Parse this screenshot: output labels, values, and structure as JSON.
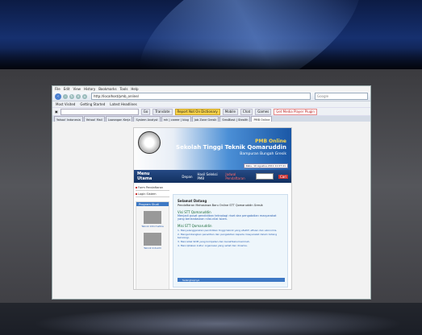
{
  "browser": {
    "menu": [
      "File",
      "Edit",
      "View",
      "History",
      "Bookmarks",
      "Tools",
      "Help"
    ],
    "url": "http://localhost/pmb_online/",
    "search_placeholder": "Google",
    "bookmarks": [
      "Most Visited",
      "Getting Started",
      "Latest Headlines"
    ],
    "toolbar_buttons": [
      "Go",
      "Translate",
      "Report Not On Dictionary",
      "Mobile",
      "Chat",
      "Games",
      "Get Media Player Plugin"
    ],
    "tabs": [
      "Yahoo! Indonesia",
      "Yahoo! Mail",
      "Lowongan Kerja",
      "System Analyst",
      "mh | career | blog",
      "Job Zone Gresik",
      "SmsBlast | Stealth",
      "PMB Online"
    ]
  },
  "site": {
    "pmb": "PMB Online",
    "name": "Sekolah Tinggi Teknik Qomaruddin",
    "address": "Bampuran Bungah Gresik",
    "date": "Rabu, 10 Agustus 2011  11:07:41",
    "nav": {
      "menu_utama": "Menu Utama",
      "links": [
        "Depan",
        "Hasil Seleksi PMB",
        "Jadwal Pendaftaran"
      ],
      "search_button": "Cari"
    },
    "sidebar": {
      "items": [
        "Form Pendaftaran",
        "Login Sistem"
      ],
      "box_title": "Program Studi",
      "captions": [
        "Teknik Informatika",
        "Teknik Industri"
      ]
    },
    "main": {
      "title": "Selamat Datang",
      "subtitle": "Pendaftaran Mahasiswa Baru Online STT Qomaruddin Gresik",
      "visi_heading": "Visi STT Qomaruddin",
      "visi": "Menjadi pusat pendidikan teknologi riset dan pengabdian masyarakat yang berlandaskan nilai-nilai Islam.",
      "misi_heading": "Misi STT Qomaruddin",
      "misi": [
        "1. Menyelenggarakan pendidikan tinggi teknik yang efektif, efisien dan ekonomis.",
        "2. Mengembangkan penelitian dan pengabdian kepada masyarakat dalam bidang teknologi.",
        "3. Mencetak SDM yang kompeten dan berakhlakul karimah.",
        "4. Menciptakan kultur organisasi yang sehat dan dinamis."
      ],
      "readmore": "Selengkapnya"
    }
  }
}
